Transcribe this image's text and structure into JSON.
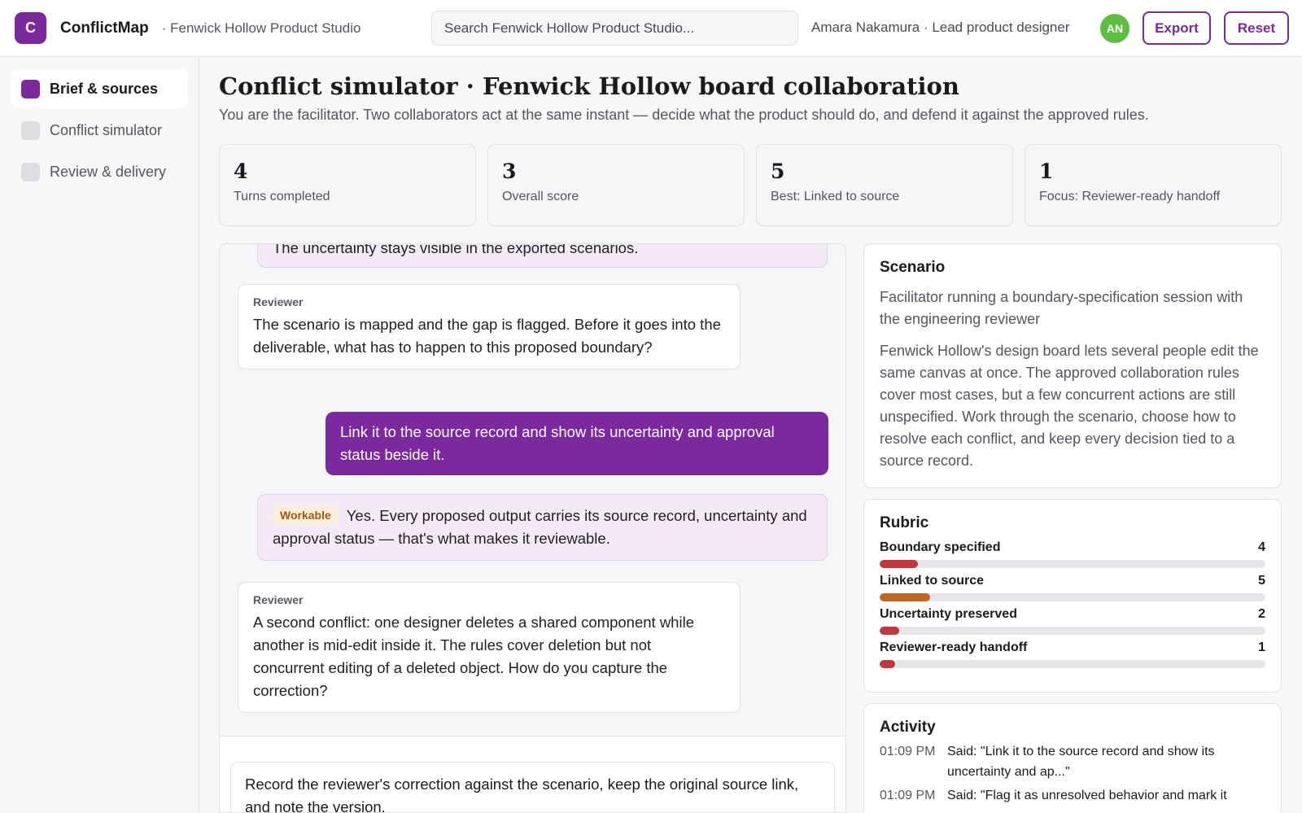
{
  "header": {
    "logo_letter": "C",
    "brand": "ConflictMap",
    "workspace": "· Fenwick Hollow Product Studio",
    "search_placeholder": "Search Fenwick Hollow Product Studio...",
    "user": "Amara Nakamura · Lead product designer",
    "avatar_initials": "AN",
    "export_label": "Export",
    "reset_label": "Reset"
  },
  "sidebar": {
    "items": [
      {
        "label": "Brief & sources",
        "active": true
      },
      {
        "label": "Conflict simulator",
        "active": false
      },
      {
        "label": "Review & delivery",
        "active": false
      }
    ]
  },
  "page": {
    "title": "Conflict simulator · Fenwick Hollow board collaboration",
    "subtitle": "You are the facilitator. Two collaborators act at the same instant — decide what the product should do, and defend it against the approved rules."
  },
  "stats": [
    {
      "value": "4",
      "label": "Turns completed"
    },
    {
      "value": "3",
      "label": "Overall score"
    },
    {
      "value": "5",
      "label": "Best: Linked to source"
    },
    {
      "value": "1",
      "label": "Focus: Reviewer-ready handoff"
    }
  ],
  "chat": {
    "messages": [
      {
        "type": "feedback",
        "text": "The uncertainty stays visible in the exported scenarios."
      },
      {
        "type": "reviewer",
        "author": "Reviewer",
        "text": "The scenario is mapped and the gap is flagged. Before it goes into the deliverable, what has to happen to this proposed boundary?"
      },
      {
        "type": "mine",
        "text": "Link it to the source record and show its uncertainty and approval status beside it."
      },
      {
        "type": "feedback",
        "tag": "Workable",
        "text": "Yes. Every proposed output carries its source record, uncertainty and approval status — that's what makes it reviewable."
      },
      {
        "type": "reviewer",
        "author": "Reviewer",
        "text": "A second conflict: one designer deletes a shared component while another is mid-edit inside it. The rules cover deletion but not concurrent editing of a deleted object. How do you capture the correction?"
      }
    ],
    "composer_text": "Record the reviewer's correction against the scenario, keep the original source link, and note the version."
  },
  "scenario": {
    "title": "Scenario",
    "subtitle": "Facilitator running a boundary-specification session with the engineering reviewer",
    "body": "Fenwick Hollow's design board lets several people edit the same canvas at once. The approved collaboration rules cover most cases, but a few concurrent actions are still unspecified. Work through the scenario, choose how to resolve each conflict, and keep every decision tied to a source record."
  },
  "rubric": {
    "title": "Rubric",
    "max": 5,
    "items": [
      {
        "label": "Boundary specified",
        "score": 4,
        "fill_fraction": 0.1,
        "color": "#c2363c"
      },
      {
        "label": "Linked to source",
        "score": 5,
        "fill_fraction": 0.13,
        "color": "#c2661f"
      },
      {
        "label": "Uncertainty preserved",
        "score": 2,
        "fill_fraction": 0.05,
        "color": "#c2363c"
      },
      {
        "label": "Reviewer-ready handoff",
        "score": 1,
        "fill_fraction": 0.04,
        "color": "#c2363c"
      }
    ]
  },
  "activity": {
    "title": "Activity",
    "items": [
      {
        "time": "01:09 PM",
        "text": "Said: \"Link it to the source record and show its uncertainty and ap...\""
      },
      {
        "time": "01:09 PM",
        "text": "Said: \"Flag it as unresolved behavior and mark it"
      }
    ]
  },
  "colors": {
    "accent": "#7a2a9c",
    "avatar": "#5cbf3f",
    "tag_bg": "#fcefd9",
    "tag_text": "#a25a12"
  }
}
